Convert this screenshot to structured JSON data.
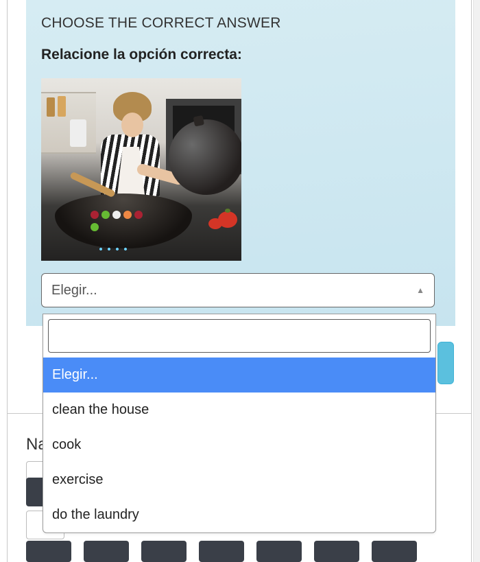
{
  "question": {
    "instruction": "CHOOSE THE CORRECT ANSWER",
    "prompt": "Relacione la opción correcta:",
    "image_alt": "woman-cooking-kitchen"
  },
  "select": {
    "selected_label": "Elegir...",
    "placeholder_option": "Elegir...",
    "options": [
      "clean the house",
      "cook",
      "exercise",
      "do the laundry"
    ]
  },
  "navigation": {
    "label_prefix": "Na"
  }
}
